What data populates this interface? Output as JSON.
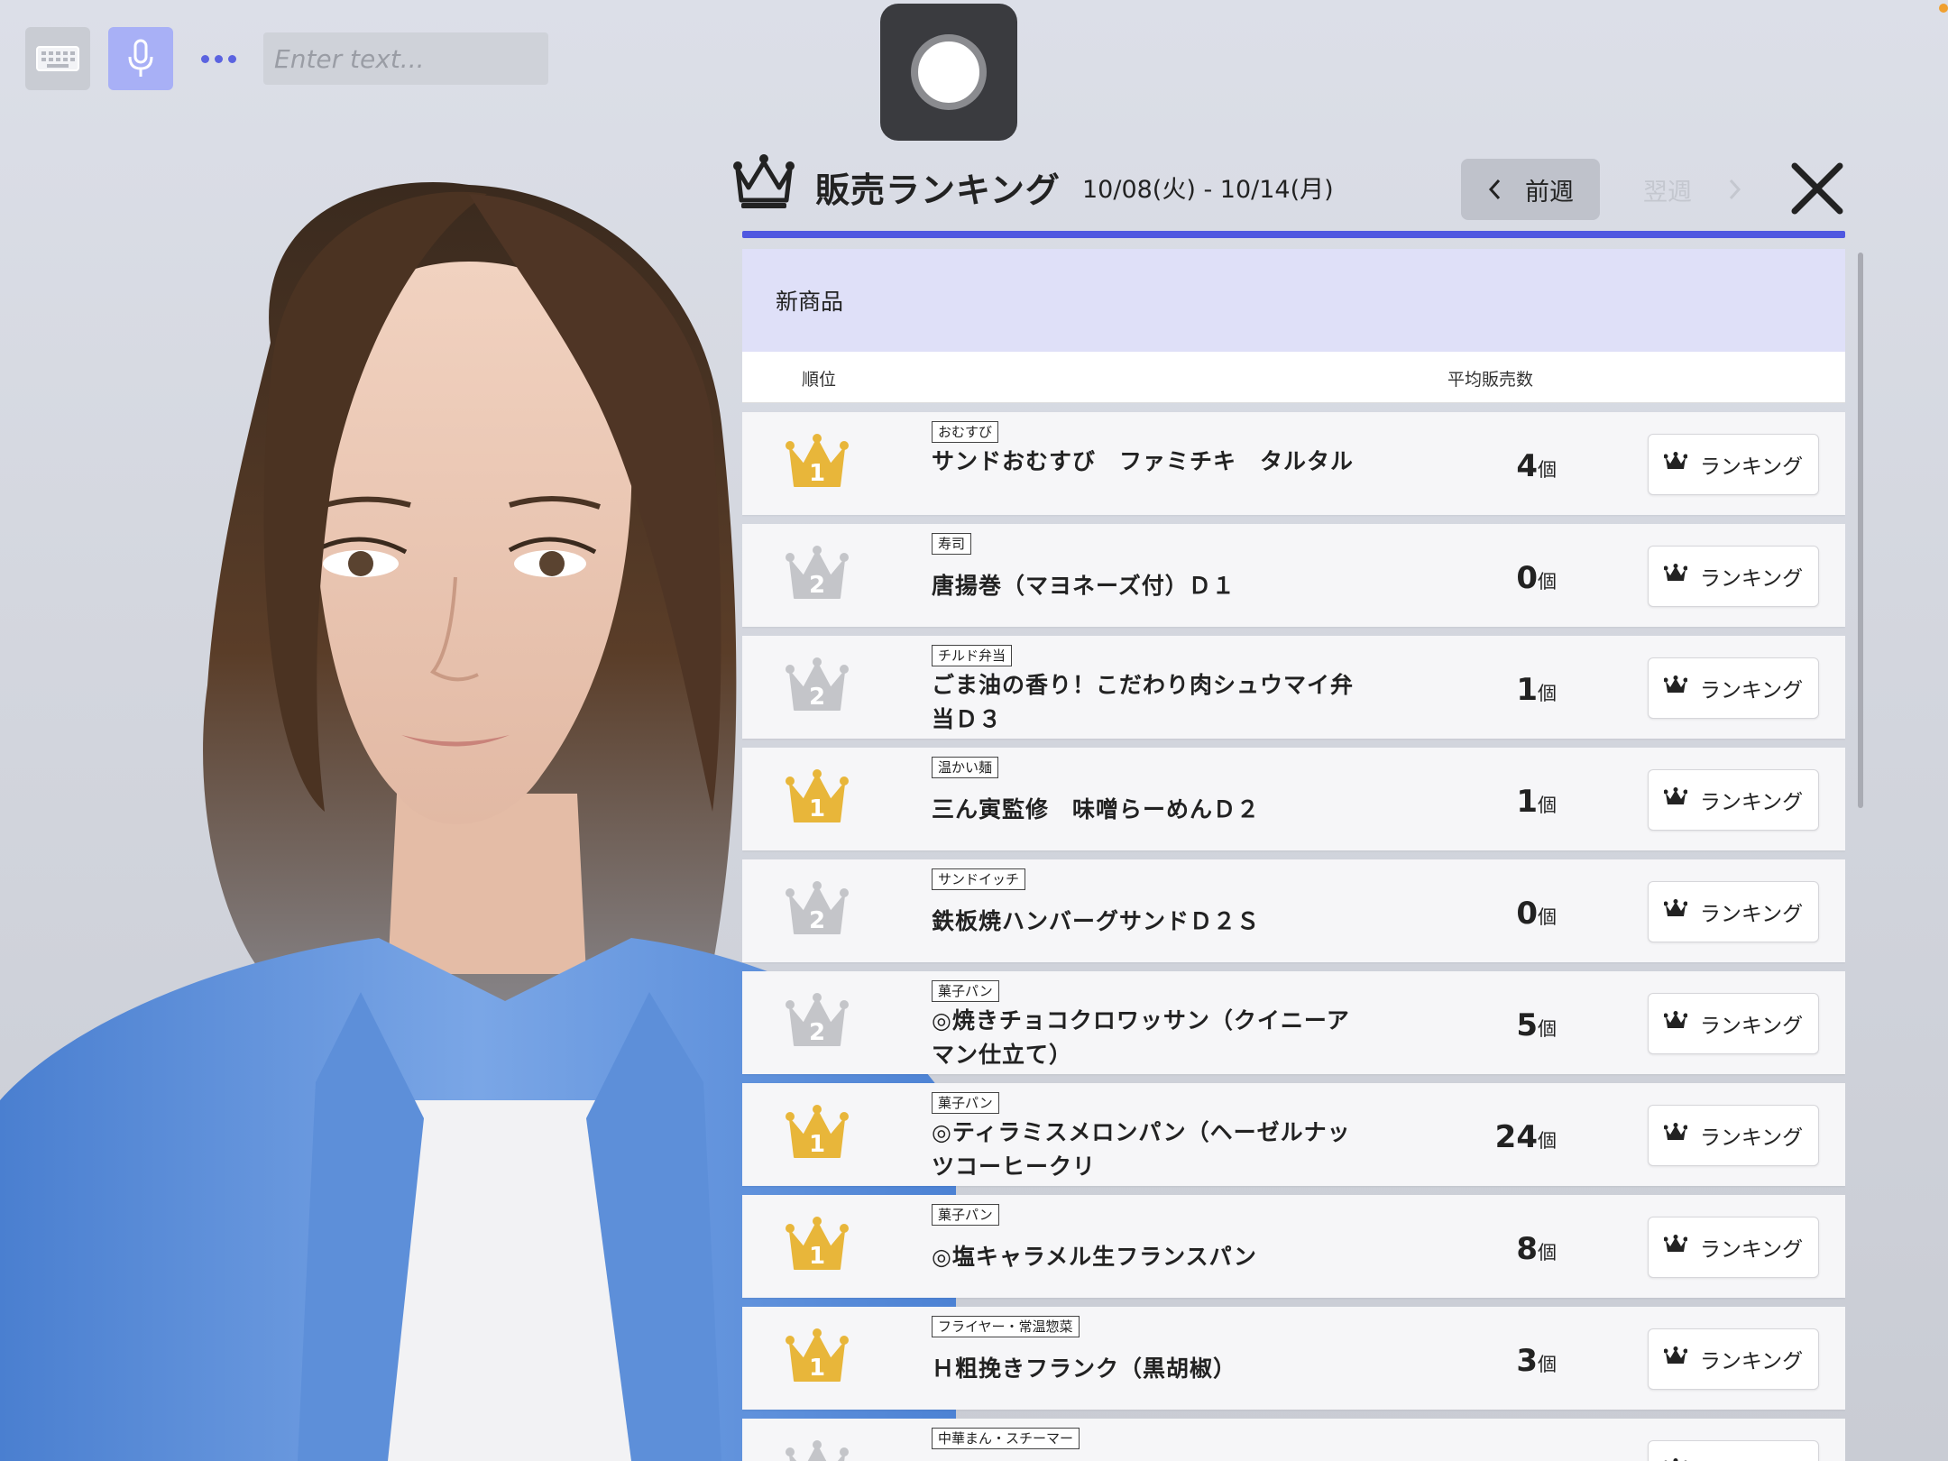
{
  "toolbar": {
    "keyboard_icon": "keyboard-icon",
    "mic_icon": "microphone-icon",
    "more_icon": "more-dots-icon",
    "input_placeholder": "Enter text...",
    "record_icon": "record-icon"
  },
  "header": {
    "title": "販売ランキング",
    "date_range": "10/08(火) - 10/14(月)",
    "prev_label": "前週",
    "next_label": "翌週"
  },
  "colors": {
    "accent": "#4f58e0",
    "gold": "#e8b63a",
    "silver": "#c4c5c9"
  },
  "list": {
    "category": "新商品",
    "col_rank": "順位",
    "col_avg": "平均販売数",
    "rank_button_label": "ランキング",
    "unit": "個",
    "items": [
      {
        "rank": "1",
        "tier": "gold",
        "tag": "おむすび",
        "name": "サンドおむすび　ファミチキ　タルタル",
        "avg": "4"
      },
      {
        "rank": "2",
        "tier": "silver",
        "tag": "寿司",
        "name": "唐揚巻（マヨネーズ付）Ｄ１",
        "avg": "0"
      },
      {
        "rank": "2",
        "tier": "silver",
        "tag": "チルド弁当",
        "name": "ごま油の香り！こだわり肉シュウマイ弁当Ｄ３",
        "avg": "1"
      },
      {
        "rank": "1",
        "tier": "gold",
        "tag": "温かい麺",
        "name": "三ん寅監修　味噌らーめんＤ２",
        "avg": "1"
      },
      {
        "rank": "2",
        "tier": "silver",
        "tag": "サンドイッチ",
        "name": "鉄板焼ハンバーグサンドＤ２Ｓ",
        "avg": "0"
      },
      {
        "rank": "2",
        "tier": "silver",
        "tag": "菓子パン",
        "name": "◎焼きチョコクロワッサン（クイニーアマン仕立て）",
        "avg": "5"
      },
      {
        "rank": "1",
        "tier": "gold",
        "tag": "菓子パン",
        "name": "◎ティラミスメロンパン（ヘーゼルナッツコーヒークリ",
        "avg": "24"
      },
      {
        "rank": "1",
        "tier": "gold",
        "tag": "菓子パン",
        "name": "◎塩キャラメル生フランスパン",
        "avg": "8"
      },
      {
        "rank": "1",
        "tier": "gold",
        "tag": "フライヤー・常温惣菜",
        "name": "Ｈ粗挽きフランク（黒胡椒）",
        "avg": "3"
      },
      {
        "rank": "",
        "tier": "silver",
        "tag": "中華まん・スチーマー",
        "name": "",
        "avg": ""
      }
    ]
  }
}
